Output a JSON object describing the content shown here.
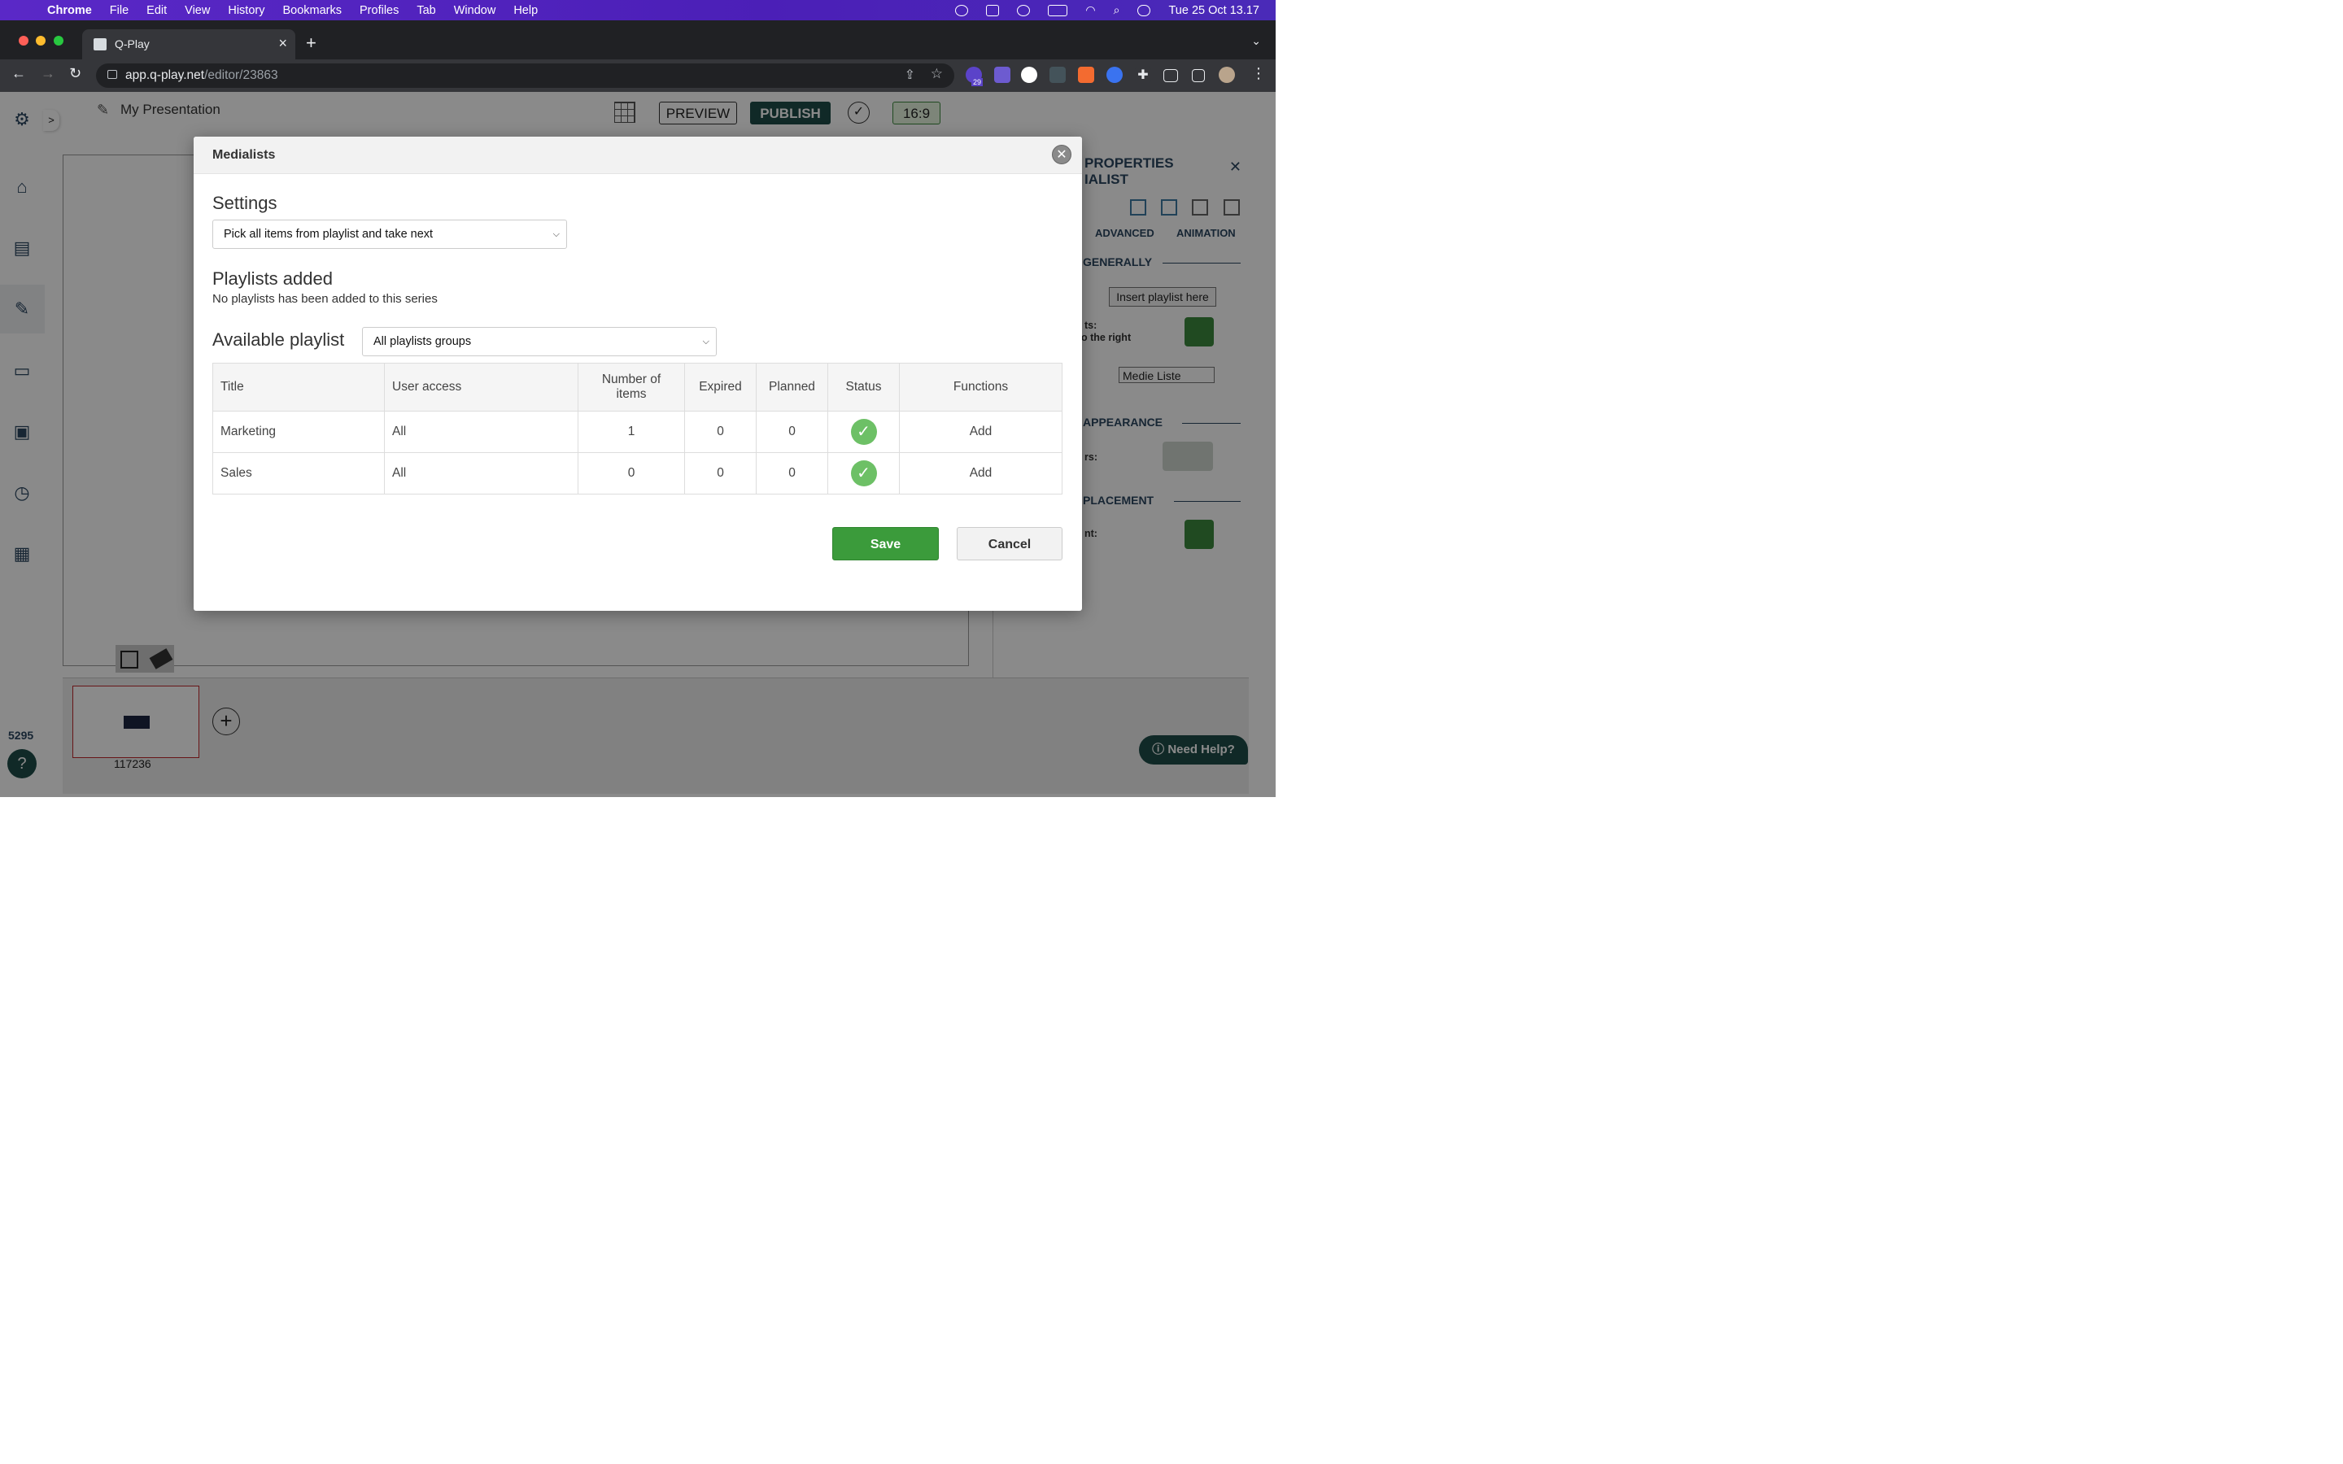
{
  "os_menubar": {
    "app_name": "Chrome",
    "menus": [
      "File",
      "Edit",
      "View",
      "History",
      "Bookmarks",
      "Profiles",
      "Tab",
      "Window",
      "Help"
    ],
    "clock": "Tue 25 Oct  13.17"
  },
  "browser": {
    "tab_title": "Q-Play",
    "url_host": "app.q-play.net",
    "url_path": "/editor/23863",
    "extension_badge": "29"
  },
  "editor": {
    "presentation_name": "My Presentation",
    "preview_label": "PREVIEW",
    "publish_label": "PUBLISH",
    "aspect_label": "16:9",
    "slide_id": "117236",
    "counter": "5295",
    "need_help_label": "Need Help?"
  },
  "properties_panel": {
    "title_line1": "PROPERTIES",
    "title_line2": "IALIST",
    "tab_advanced": "ADVANCED",
    "tab_animation": "ANIMATION",
    "section_generally": "GENERALLY",
    "insert_playlist_label": "Insert playlist here",
    "partial_label_1": "ts:",
    "partial_label_2": "o the right",
    "list_select_value": "Medie Liste",
    "section_appearance": "APPEARANCE",
    "partial_label_3": "rs:",
    "section_placement": "PLACEMENT",
    "partial_label_4": "nt:"
  },
  "modal": {
    "title": "Medialists",
    "settings_heading": "Settings",
    "settings_select_value": "Pick all items from playlist and take next",
    "playlists_added_heading": "Playlists added",
    "playlists_added_empty": "No playlists has been added to this series",
    "available_heading": "Available playlist",
    "group_select_value": "All playlists groups",
    "table": {
      "headers": [
        "Title",
        "User access",
        "Number of items",
        "Expired",
        "Planned",
        "Status",
        "Functions"
      ],
      "rows": [
        {
          "title": "Marketing",
          "access": "All",
          "items": "1",
          "expired": "0",
          "planned": "0",
          "status": "active",
          "function": "Add"
        },
        {
          "title": "Sales",
          "access": "All",
          "items": "0",
          "expired": "0",
          "planned": "0",
          "status": "active",
          "function": "Add"
        }
      ]
    },
    "save_label": "Save",
    "cancel_label": "Cancel"
  },
  "colors": {
    "menubar": "#4b1fb7",
    "save_green": "#3b9b3b",
    "status_green": "#6dc066",
    "brand_dark": "#1f4d49"
  }
}
